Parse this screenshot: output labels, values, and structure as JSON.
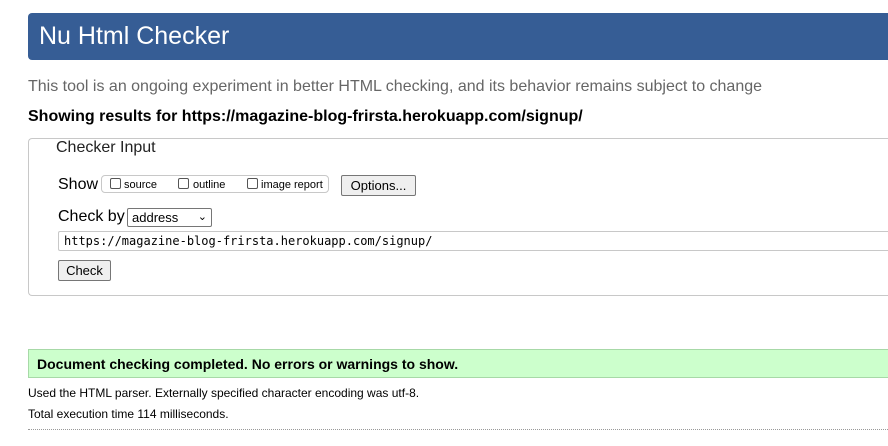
{
  "header": {
    "title": "Nu Html Checker",
    "background_color": "#365d95"
  },
  "tagline": "This tool is an ongoing experiment in better HTML checking, and its behavior remains subject to change",
  "results_for": "Showing results for https://magazine-blog-frirsta.herokuapp.com/signup/",
  "checker_input": {
    "legend": "Checker Input",
    "show_label": "Show",
    "show_options": [
      {
        "label": "source",
        "checked": false
      },
      {
        "label": "outline",
        "checked": false
      },
      {
        "label": "image report",
        "checked": false
      }
    ],
    "options_button": "Options...",
    "check_by_label": "Check by",
    "check_by_selected": "address",
    "url_value": "https://magazine-blog-frirsta.herokuapp.com/signup/",
    "check_button": "Check"
  },
  "result": {
    "message": "Document checking completed. No errors or warnings to show.",
    "color": "#ccffcc"
  },
  "info": {
    "parser_line": "Used the HTML parser. Externally specified character encoding was utf-8.",
    "time_line": "Total execution time 114 milliseconds."
  }
}
